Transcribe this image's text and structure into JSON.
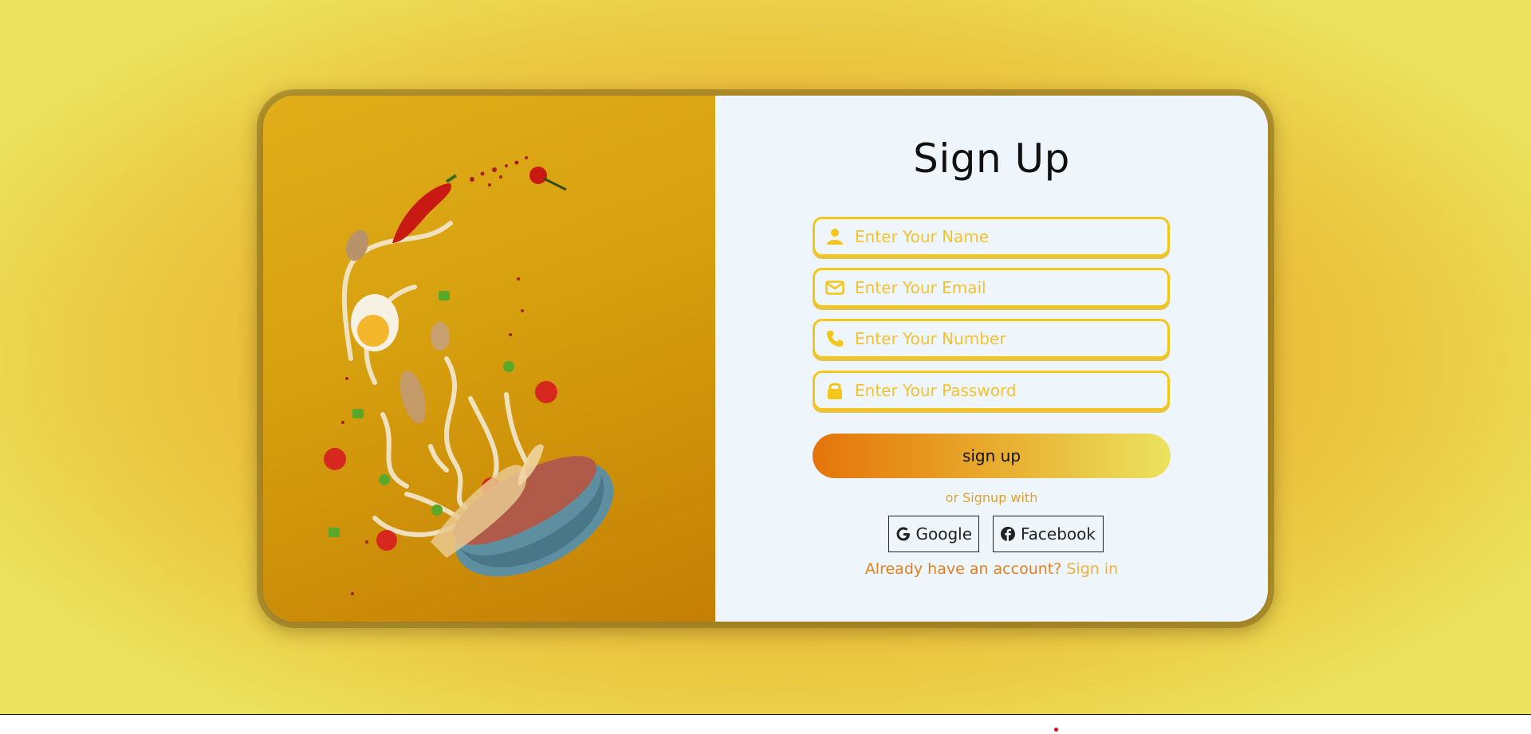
{
  "form": {
    "title": "Sign Up",
    "fields": [
      {
        "icon": "user-icon",
        "placeholder": "Enter Your Name"
      },
      {
        "icon": "envelope-icon",
        "placeholder": "Enter Your Email"
      },
      {
        "icon": "phone-icon",
        "placeholder": "Enter Your Number"
      },
      {
        "icon": "lock-icon",
        "placeholder": "Enter Your Password"
      }
    ],
    "submit_label": "sign up",
    "alt_signup_text": "or Signup with",
    "social": {
      "google_label": "Google",
      "facebook_label": "Facebook"
    },
    "account_prompt": "Already have an account?",
    "signin_link": "Sign in"
  },
  "colors": {
    "accent_yellow": "#f5c518",
    "gradient_start": "#e4740a",
    "gradient_end": "#ebe35e",
    "panel_bg": "#eef6fc",
    "link_orange": "#e37f1f"
  }
}
